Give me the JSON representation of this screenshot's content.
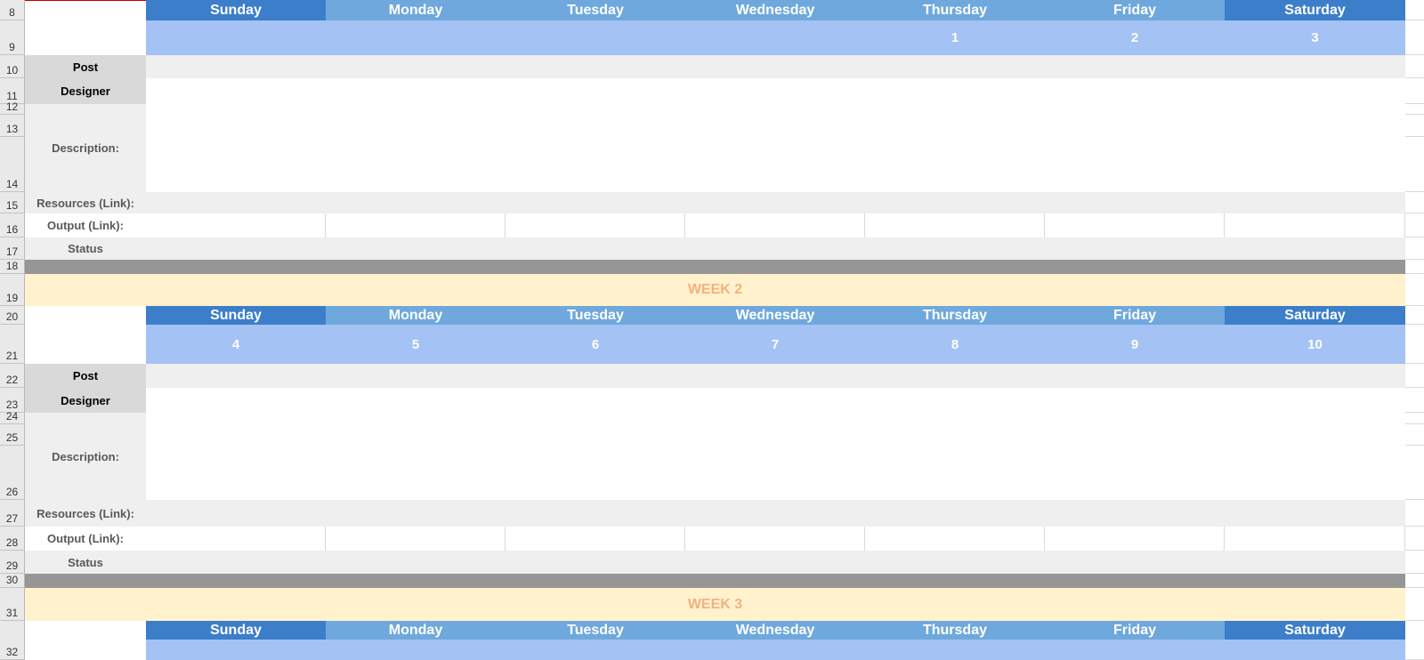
{
  "days": [
    "Sunday",
    "Monday",
    "Tuesday",
    "Wednesday",
    "Thursday",
    "Friday",
    "Saturday"
  ],
  "colors": {
    "weekend_header": "#3c7ec9",
    "weekday_header": "#6fa8dc",
    "date_row": "#a4c2f4",
    "label_dark": "#d9d9d9",
    "label_light": "#efefef",
    "divider": "#969696",
    "banner_bg": "#fff2cc",
    "banner_text": "#f4b183"
  },
  "row_numbers": [
    "8",
    "9",
    "10",
    "11",
    "12",
    "13",
    "14",
    "15",
    "16",
    "17",
    "18",
    "19",
    "20",
    "21",
    "22",
    "23",
    "24",
    "25",
    "26",
    "27",
    "28",
    "29",
    "30",
    "31",
    "32"
  ],
  "labels": {
    "post": "Post",
    "designer": "Designer",
    "description": "Description:",
    "resources": "Resources (Link):",
    "output": "Output (Link):",
    "status": "Status"
  },
  "week1": {
    "dates": [
      "",
      "",
      "",
      "",
      "1",
      "2",
      "3"
    ]
  },
  "week2": {
    "banner": "WEEK 2",
    "dates": [
      "4",
      "5",
      "6",
      "7",
      "8",
      "9",
      "10"
    ]
  },
  "week3": {
    "banner": "WEEK 3"
  }
}
